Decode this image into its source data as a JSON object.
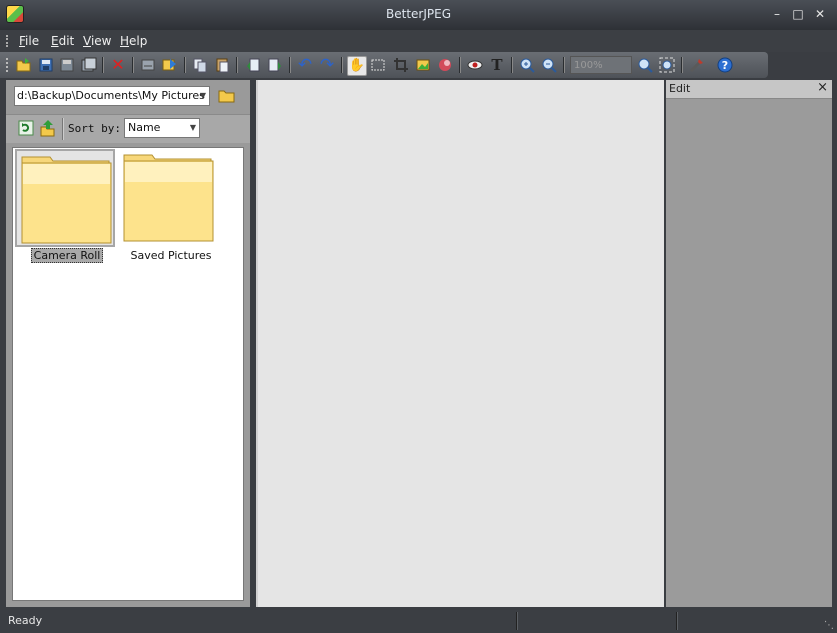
{
  "window": {
    "title": "BetterJPEG"
  },
  "menu": {
    "items": [
      "File",
      "Edit",
      "View",
      "Help"
    ]
  },
  "toolbar": {
    "zoom_value": "100%"
  },
  "browser": {
    "path": "d:\\Backup\\Documents\\My Pictures",
    "sort_label": "Sort by:",
    "sort_value": "Name",
    "folders": [
      {
        "name": "Camera Roll",
        "selected": true
      },
      {
        "name": "Saved Pictures",
        "selected": false
      }
    ]
  },
  "edit_panel": {
    "title": "Edit",
    "close": "×"
  },
  "status": {
    "text": "Ready"
  }
}
